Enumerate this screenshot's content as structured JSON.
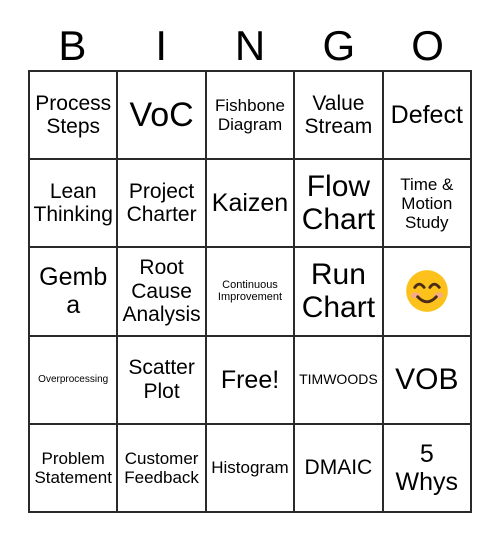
{
  "card": {
    "title": "BINGO",
    "header_letters": [
      "B",
      "I",
      "N",
      "G",
      "O"
    ],
    "grid_size": "5x5",
    "free_space_label": "Free!",
    "colors": {
      "grid_line": "#2a2a2a",
      "background": "#ffffff",
      "text": "#000000",
      "emoji_face": "#fcc21b",
      "emoji_blush": "#f4a4a0"
    },
    "rows": [
      [
        {
          "text": "Process Steps",
          "size": "md",
          "type": "text"
        },
        {
          "text": "VoC",
          "size": "xxl",
          "type": "text"
        },
        {
          "text": "Fishbone Diagram",
          "size": "sm",
          "type": "text"
        },
        {
          "text": "Value Stream",
          "size": "md",
          "type": "text"
        },
        {
          "text": "Defect",
          "size": "lg",
          "type": "text"
        }
      ],
      [
        {
          "text": "Lean Thinking",
          "size": "md",
          "type": "text"
        },
        {
          "text": "Project Charter",
          "size": "md",
          "type": "text"
        },
        {
          "text": "Kaizen",
          "size": "lg",
          "type": "text"
        },
        {
          "text": "Flow Chart",
          "size": "xl",
          "type": "text"
        },
        {
          "text": "Time & Motion Study",
          "size": "sm",
          "type": "text"
        }
      ],
      [
        {
          "text": "Gemba",
          "size": "lg",
          "type": "text"
        },
        {
          "text": "Root Cause Analysis",
          "size": "md",
          "type": "text"
        },
        {
          "text": "Continuous Improvement",
          "size": "xxs",
          "type": "text"
        },
        {
          "text": "Run Chart",
          "size": "xl",
          "type": "text"
        },
        {
          "text": "",
          "size": "md",
          "type": "emoji",
          "emoji_name": "smiling-face-with-smiling-eyes"
        }
      ],
      [
        {
          "text": "Overprocessing",
          "size": "tiny",
          "type": "text"
        },
        {
          "text": "Scatter Plot",
          "size": "md",
          "type": "text"
        },
        {
          "text": "Free!",
          "size": "lg",
          "type": "free"
        },
        {
          "text": "TIMWOODS",
          "size": "xs",
          "type": "text"
        },
        {
          "text": "VOB",
          "size": "xl",
          "type": "text"
        }
      ],
      [
        {
          "text": "Problem Statement",
          "size": "sm",
          "type": "text"
        },
        {
          "text": "Customer Feedback",
          "size": "sm",
          "type": "text"
        },
        {
          "text": "Histogram",
          "size": "sm",
          "type": "text"
        },
        {
          "text": "DMAIC",
          "size": "md",
          "type": "text"
        },
        {
          "text": "5 Whys",
          "size": "lg",
          "type": "text"
        }
      ]
    ]
  }
}
